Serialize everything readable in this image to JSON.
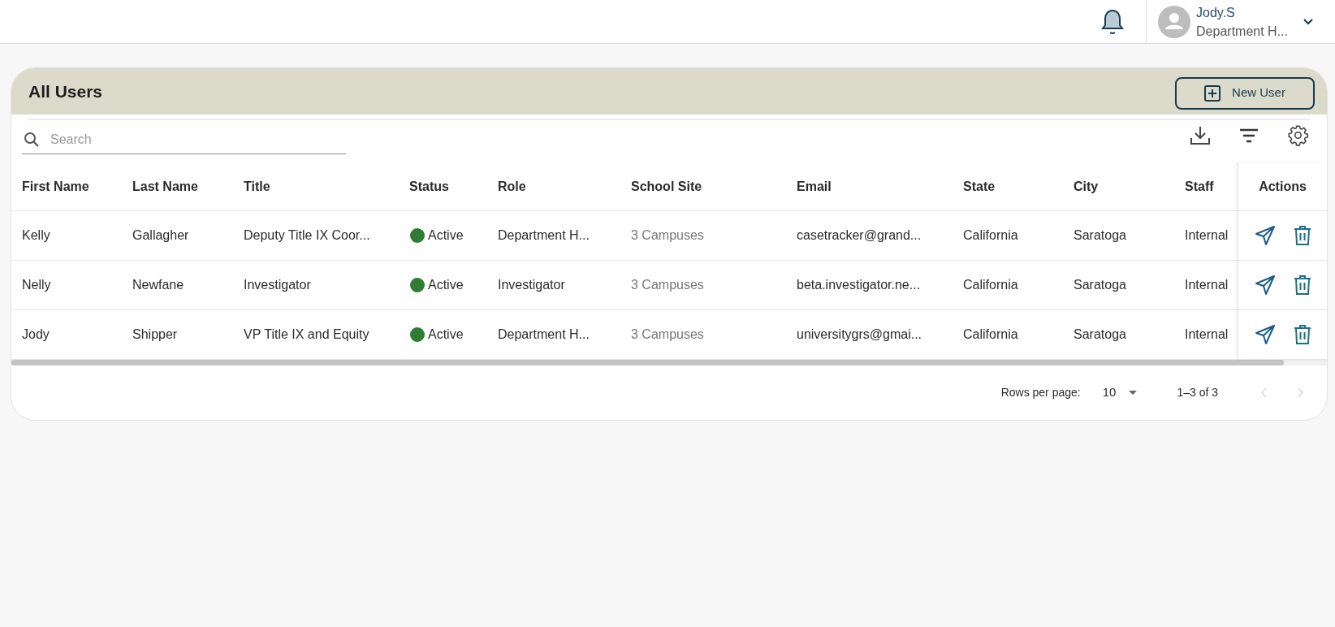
{
  "user": {
    "name": "Jody.S",
    "role": "Department H..."
  },
  "card": {
    "title": "All Users",
    "new_button": "New User",
    "search": {
      "placeholder": "Search"
    }
  },
  "table": {
    "columns": [
      "First Name",
      "Last Name",
      "Title",
      "Status",
      "Role",
      "School Site",
      "Email",
      "State",
      "City",
      "Staff"
    ],
    "actions_heading": "Actions",
    "rows": [
      {
        "cells": [
          "Kelly",
          "Gallagher",
          "Deputy Title IX Coor...",
          "Active",
          "Department H...",
          "3 Campuses",
          "casetracker@grand...",
          "California",
          "Saratoga",
          "Internal"
        ]
      },
      {
        "cells": [
          "Nelly",
          "Newfane",
          "Investigator",
          "Active",
          "Investigator",
          "3 Campuses",
          "beta.investigator.ne...",
          "California",
          "Saratoga",
          "Internal"
        ]
      },
      {
        "cells": [
          "Jody",
          "Shipper",
          "VP Title IX and Equity",
          "Active",
          "Department H...",
          "3 Campuses",
          "universitygrs@gmai...",
          "California",
          "Saratoga",
          "Internal"
        ]
      }
    ]
  },
  "pagination": {
    "rows_per_page_label": "Rows per page:",
    "rows_per_page": "10",
    "range": "1–3 of 3",
    "prev_disabled": true,
    "next_disabled": true
  }
}
